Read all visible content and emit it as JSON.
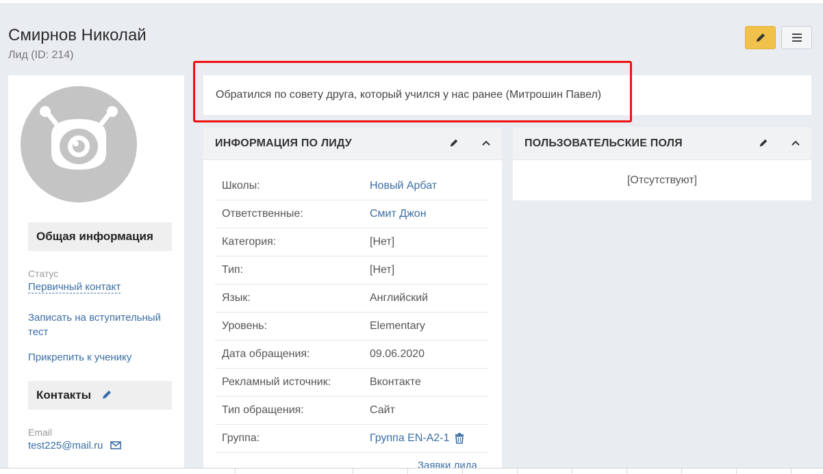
{
  "header": {
    "title": "Смирнов Николай",
    "subtitle": "Лид (ID: 214)",
    "edit_icon": "pencil-icon",
    "menu_icon": "hamburger-icon"
  },
  "note": {
    "text": "Обратился по совету друга, который учился у нас ранее (Митрошин Павел)"
  },
  "sidebar": {
    "general_title": "Общая информация",
    "status_label": "Статус",
    "status_value": "Первичный контакт",
    "action_test": "Записать на вступительный тест",
    "action_attach": "Прикрепить к ученику",
    "contacts_title": "Контакты",
    "email_label": "Email",
    "email_value": "test225@mail.ru"
  },
  "lead_info": {
    "title": "ИНФОРМАЦИЯ ПО ЛИДУ",
    "rows": [
      {
        "label": "Школы:",
        "value": "Новый Арбат",
        "link": true
      },
      {
        "label": "Ответственные:",
        "value": "Смит Джон",
        "link": true
      },
      {
        "label": "Категория:",
        "value": "[Нет]",
        "link": false
      },
      {
        "label": "Тип:",
        "value": "[Нет]",
        "link": false
      },
      {
        "label": "Язык:",
        "value": "Английский",
        "link": false
      },
      {
        "label": "Уровень:",
        "value": "Elementary",
        "link": false
      },
      {
        "label": "Дата обращения:",
        "value": "09.06.2020",
        "link": false
      },
      {
        "label": "Рекламный источник:",
        "value": "Вконтакте",
        "link": false
      },
      {
        "label": "Тип обращения:",
        "value": "Сайт",
        "link": false
      },
      {
        "label": "Группа:",
        "value": "Группа EN-A2-1",
        "link": true
      }
    ],
    "requests_link": "Заявки лида"
  },
  "custom_fields": {
    "title": "ПОЛЬЗОВАТЕЛЬСКИЕ ПОЛЯ",
    "empty_text": "[Отсутствуют]"
  },
  "colors": {
    "accent_yellow": "#f1c24b",
    "link_blue": "#3a6ea5",
    "highlight_red": "#f00f0f"
  }
}
